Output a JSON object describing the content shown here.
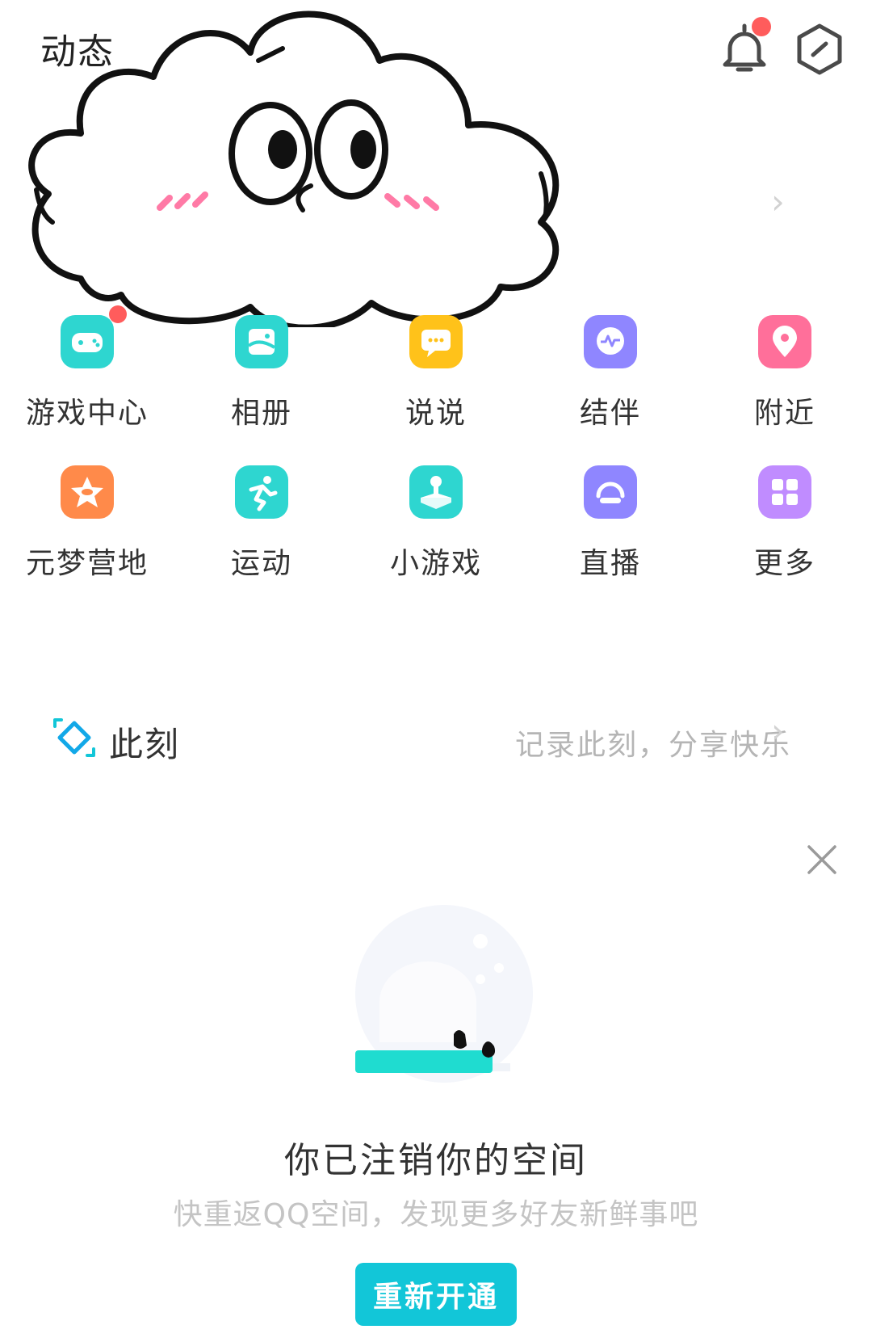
{
  "header": {
    "title": "动态",
    "icons": [
      "bell-icon",
      "hexagon-icon"
    ]
  },
  "apps": [
    {
      "label": "游戏中心",
      "icon": "gamepad-icon",
      "color": "#2ed6d0",
      "badge": true
    },
    {
      "label": "相册",
      "icon": "photo-album-icon",
      "color": "#2ed6d0",
      "badge": false
    },
    {
      "label": "说说",
      "icon": "chat-bubble-icon",
      "color": "#ffc21a",
      "badge": false
    },
    {
      "label": "结伴",
      "icon": "heartbeat-chat-icon",
      "color": "#8f86ff",
      "badge": false
    },
    {
      "label": "附近",
      "icon": "location-pin-icon",
      "color": "#ff6f9a",
      "badge": false
    },
    {
      "label": "元梦营地",
      "icon": "star-cat-icon",
      "color": "#ff8a4a",
      "badge": false
    },
    {
      "label": "运动",
      "icon": "running-icon",
      "color": "#2ed6d0",
      "badge": false
    },
    {
      "label": "小游戏",
      "icon": "joystick-icon",
      "color": "#2ed6d0",
      "badge": false
    },
    {
      "label": "直播",
      "icon": "live-icon",
      "color": "#8f86ff",
      "badge": false
    },
    {
      "label": "更多",
      "icon": "grid-more-icon",
      "color": "#c08cff",
      "badge": false
    }
  ],
  "moment": {
    "title": "此刻",
    "hint": "记录此刻，分享快乐"
  },
  "empty_state": {
    "title": "你已注销你的空间",
    "subtitle": "快重返QQ空间，发现更多好友新鲜事吧",
    "button": "重新开通"
  },
  "colors": {
    "accent": "#12c6d8",
    "badge": "#ff5c5c"
  }
}
